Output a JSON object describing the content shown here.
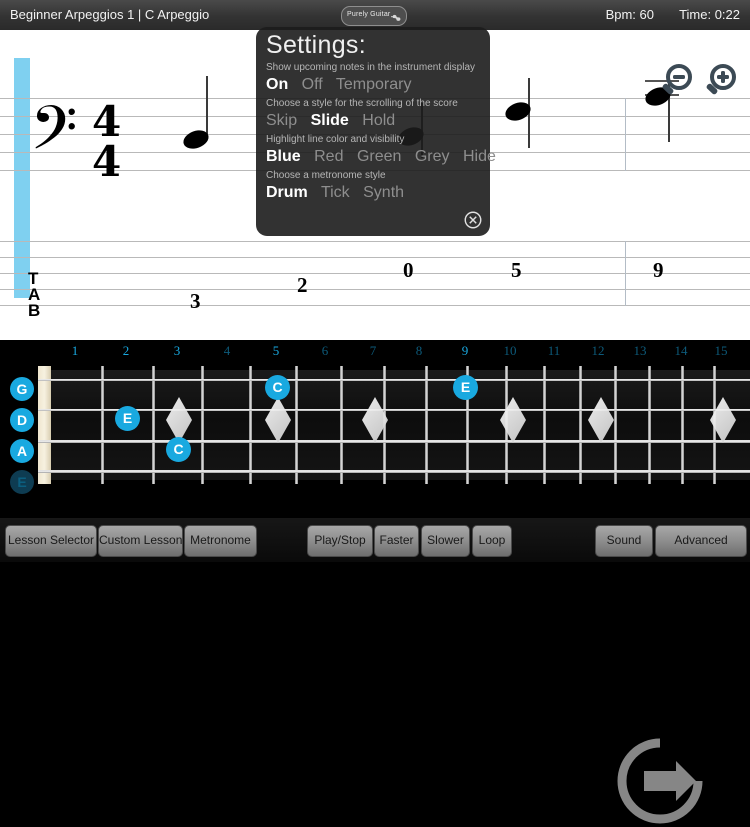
{
  "header": {
    "title": "Beginner Arpeggios 1 | C Arpeggio",
    "bpm_label": "Bpm: 60",
    "time_label": "Time: 0:22",
    "logo_text": "Purely Guitar"
  },
  "score": {
    "clef": "𝄢",
    "time_signature": {
      "top": "4",
      "bottom": "4"
    },
    "tab_label": {
      "t": "T",
      "a": "A",
      "b": "B"
    },
    "tab_numbers": [
      "3",
      "2",
      "0",
      "5",
      "9"
    ],
    "zoom_out_icon": "magnifier-minus-icon",
    "zoom_in_icon": "magnifier-plus-icon",
    "scroll_left": "‹",
    "scroll_right": "›",
    "highlight_color": "#7fd0f0"
  },
  "settings": {
    "title": "Settings:",
    "groups": [
      {
        "description": "Show upcoming notes in the instrument display",
        "options": [
          "On",
          "Off",
          "Temporary"
        ],
        "selected": "On"
      },
      {
        "description": "Choose a style for the scrolling of the score",
        "options": [
          "Skip",
          "Slide",
          "Hold"
        ],
        "selected": "Slide"
      },
      {
        "description": "Highlight line color and visibility",
        "options": [
          "Blue",
          "Red",
          "Green",
          "Grey",
          "Hide"
        ],
        "selected": "Blue"
      },
      {
        "description": "Choose a metronome style",
        "options": [
          "Drum",
          "Tick",
          "Synth"
        ],
        "selected": "Drum"
      }
    ],
    "close_icon": "close-circle-icon"
  },
  "fretboard": {
    "fret_numbers": [
      "1",
      "2",
      "3",
      "4",
      "5",
      "6",
      "7",
      "8",
      "9",
      "10",
      "11",
      "12",
      "13",
      "14",
      "15"
    ],
    "active_frets": [
      "2",
      "3",
      "5",
      "9"
    ],
    "strings": [
      {
        "name": "G",
        "active": true
      },
      {
        "name": "D",
        "active": true
      },
      {
        "name": "A",
        "active": true
      },
      {
        "name": "E",
        "active": false
      }
    ],
    "notes": [
      {
        "label": "C",
        "string": "G",
        "fret": 5
      },
      {
        "label": "E",
        "string": "D",
        "fret": 2
      },
      {
        "label": "C",
        "string": "A",
        "fret": 3
      },
      {
        "label": "E",
        "string": "G",
        "fret": 9
      }
    ],
    "loop_icon": "loop-arrow-icon"
  },
  "toolbar": {
    "buttons": [
      "Lesson Selector",
      "Custom Lesson",
      "Metronome",
      "Play/Stop",
      "Faster",
      "Slower",
      "Loop",
      "Sound",
      "Advanced"
    ]
  },
  "colors": {
    "accent": "#19a9e0",
    "highlight": "#7fd0f0",
    "panel": "#1c1c1c"
  }
}
